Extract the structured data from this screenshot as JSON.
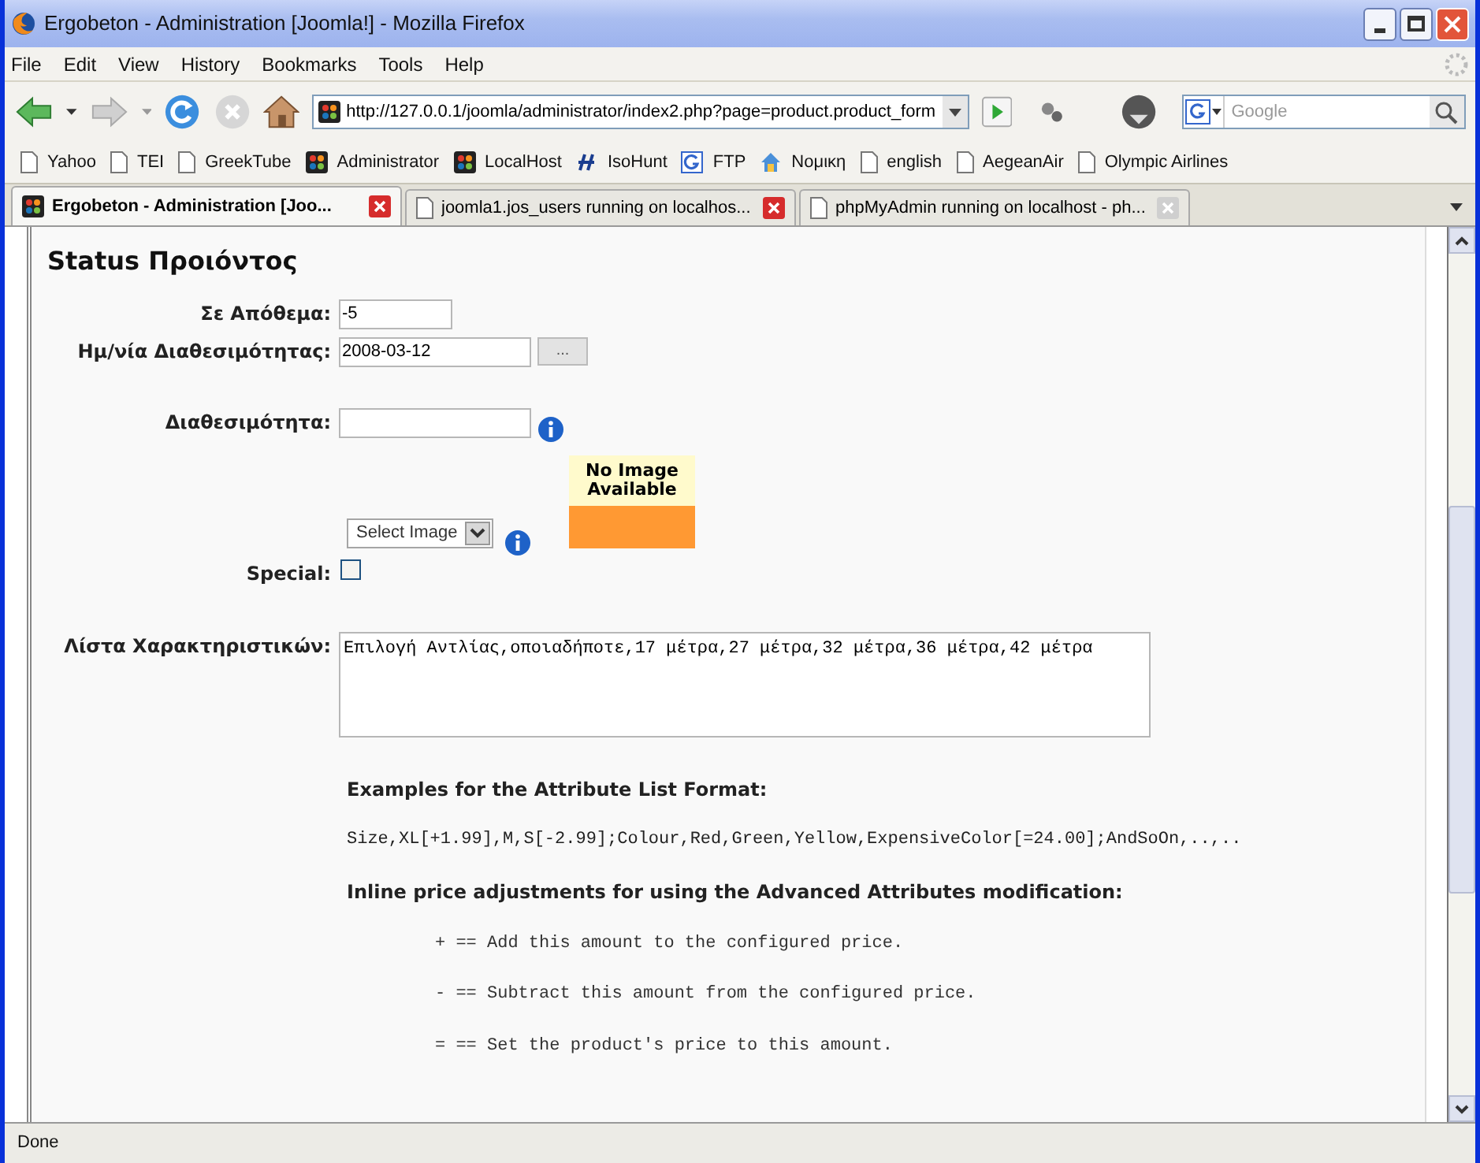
{
  "window": {
    "title": "Ergobeton - Administration [Joomla!] - Mozilla Firefox"
  },
  "menu": [
    "File",
    "Edit",
    "View",
    "History",
    "Bookmarks",
    "Tools",
    "Help"
  ],
  "navigation": {
    "url": "http://127.0.0.1/joomla/administrator/index2.php?page=product.product_form",
    "search_placeholder": "Google"
  },
  "bookmarks": [
    {
      "label": "Yahoo",
      "kind": "page"
    },
    {
      "label": "TEI",
      "kind": "page"
    },
    {
      "label": "GreekTube",
      "kind": "page"
    },
    {
      "label": "Administrator",
      "kind": "joomla"
    },
    {
      "label": "LocalHost",
      "kind": "joomla"
    },
    {
      "label": "IsoHunt",
      "kind": "isohunt"
    },
    {
      "label": "FTP",
      "kind": "google"
    },
    {
      "label": "Νομικη",
      "kind": "house"
    },
    {
      "label": "english",
      "kind": "page"
    },
    {
      "label": "AegeanAir",
      "kind": "page"
    },
    {
      "label": "Olympic Airlines",
      "kind": "page"
    }
  ],
  "tabs": [
    {
      "label": "Ergobeton - Administration [Joo...",
      "selected": true,
      "kind": "joomla",
      "close_highlighted": true
    },
    {
      "label": "joomla1.jos_users running on localhos...",
      "selected": false,
      "kind": "page",
      "close_highlighted": true
    },
    {
      "label": "phpMyAdmin running on localhost - ph...",
      "selected": false,
      "kind": "page",
      "close_highlighted": false
    }
  ],
  "form": {
    "heading": "Status Προιόντος",
    "fields": [
      {
        "kind": "text",
        "label": "Σε Απόθεμα:",
        "value": "-5"
      },
      {
        "kind": "date",
        "label": "Ημ/νία Διαθεσιμότητας:",
        "value": "2008-03-12",
        "button": "..."
      },
      {
        "kind": "text_info",
        "label": "Διαθεσιμότητα:"
      },
      {
        "kind": "image",
        "select": "Select Image",
        "preview": "No Image Available"
      },
      {
        "kind": "checkbox",
        "label": "Special:",
        "checked": false
      },
      {
        "kind": "textarea",
        "label": "Λίστα Χαρακτηριστικών:",
        "value": "Επιλογή Αντλίας,οποιαδήποτε,17 μέτρα,27 μέτρα,32 μέτρα,36 μέτρα,42 μέτρα"
      }
    ]
  },
  "help": {
    "examples_heading": "Examples for the Attribute List Format:",
    "example": "Size,XL[+1.99],M,S[-2.99];Colour,Red,Green,Yellow,ExpensiveColor[=24.00];AndSoOn,..,..",
    "inline_heading": "Inline price adjustments for using the Advanced Attributes modification:",
    "rules": [
      "+ == Add this amount to the configured price.",
      "- == Subtract this amount from the configured price.",
      "= == Set the product's price to this amount."
    ]
  },
  "status_bar": "Done"
}
